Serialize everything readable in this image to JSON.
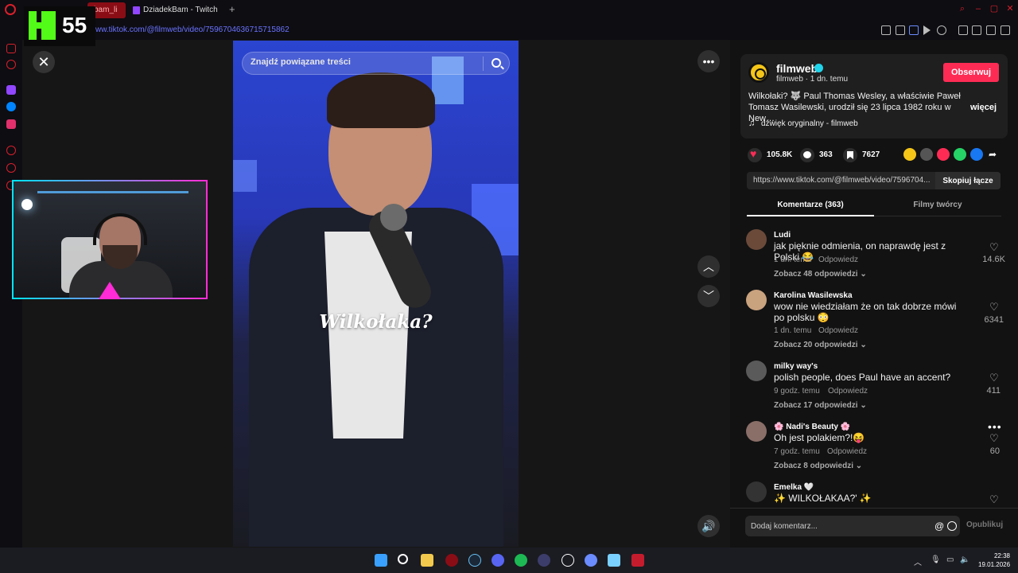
{
  "browser": {
    "tabs": [
      {
        "label": "bam_li",
        "active": true
      },
      {
        "label": "DziadekBam - Twitch",
        "active": false
      }
    ],
    "new_tab": "+",
    "url": "ww.tiktok.com/@filmweb/video/7596704636715715862"
  },
  "kick_overlay": {
    "count": "55"
  },
  "search": {
    "placeholder": "Znajdź powiązane treści"
  },
  "video": {
    "caption": "Wilkołaka?"
  },
  "author": {
    "name": "filmweb",
    "meta": "filmweb · 1 dn. temu",
    "follow_label": "Obserwuj",
    "description": "Wilkołaki? 🐺 Paul Thomas Wesley, a właściwie Paweł Tomasz Wasilewski, urodził się 23 lipca 1982 roku w New…",
    "more_label": "więcej",
    "music": "dźwięk oryginalny - filmweb"
  },
  "stats": {
    "likes": "105.8K",
    "comments": "363",
    "saves": "7627"
  },
  "share_colors": [
    "#f5c518",
    "#555555",
    "#fe2c55",
    "#25d366",
    "#1877f2"
  ],
  "share_link": {
    "url": "https://www.tiktok.com/@filmweb/video/7596704...",
    "copy_label": "Skopiuj łącze"
  },
  "panel_tabs": {
    "comments": "Komentarze (363)",
    "creator": "Filmy twórcy"
  },
  "comments": [
    {
      "user": "Ludi",
      "text": "jak pięknie odmienia, on naprawdę jest z Polski 😂",
      "time": "1 dn. temu",
      "reply": "Odpowiedz",
      "view": "Zobacz 48 odpowiedzi ⌄",
      "likes": "14.6K",
      "avatar_color": "#6b4a3a"
    },
    {
      "user": "Karolina Wasilewska",
      "text": "wow nie wiedziałam że on tak dobrze mówi po polsku 😳",
      "time": "1 dn. temu",
      "reply": "Odpowiedz",
      "view": "Zobacz 20 odpowiedzi ⌄",
      "likes": "6341",
      "avatar_color": "#c9a27e"
    },
    {
      "user": "milky way's",
      "text": "polish people, does Paul have an accent?",
      "time": "9 godz. temu",
      "reply": "Odpowiedz",
      "view": "Zobacz 17 odpowiedzi ⌄",
      "likes": "411",
      "avatar_color": "#5a5a5a"
    },
    {
      "user": "🌸 Nadi's Beauty 🌸",
      "text": "Oh jest polakiem?!😝",
      "time": "7 godz. temu",
      "reply": "Odpowiedz",
      "view": "Zobacz 8 odpowiedzi ⌄",
      "likes": "60",
      "avatar_color": "#8a6e68"
    },
    {
      "user": "Emelka 🤍",
      "text": "✨ WILKOŁAKAA?' ✨",
      "time": "",
      "reply": "",
      "view": "",
      "likes": "",
      "avatar_color": "#333333"
    }
  ],
  "comment_box": {
    "placeholder": "Dodaj komentarz...",
    "at": "@",
    "publish_label": "Opublikuj"
  },
  "taskbar": {
    "time": "22:38",
    "date": "19.01.2026"
  }
}
